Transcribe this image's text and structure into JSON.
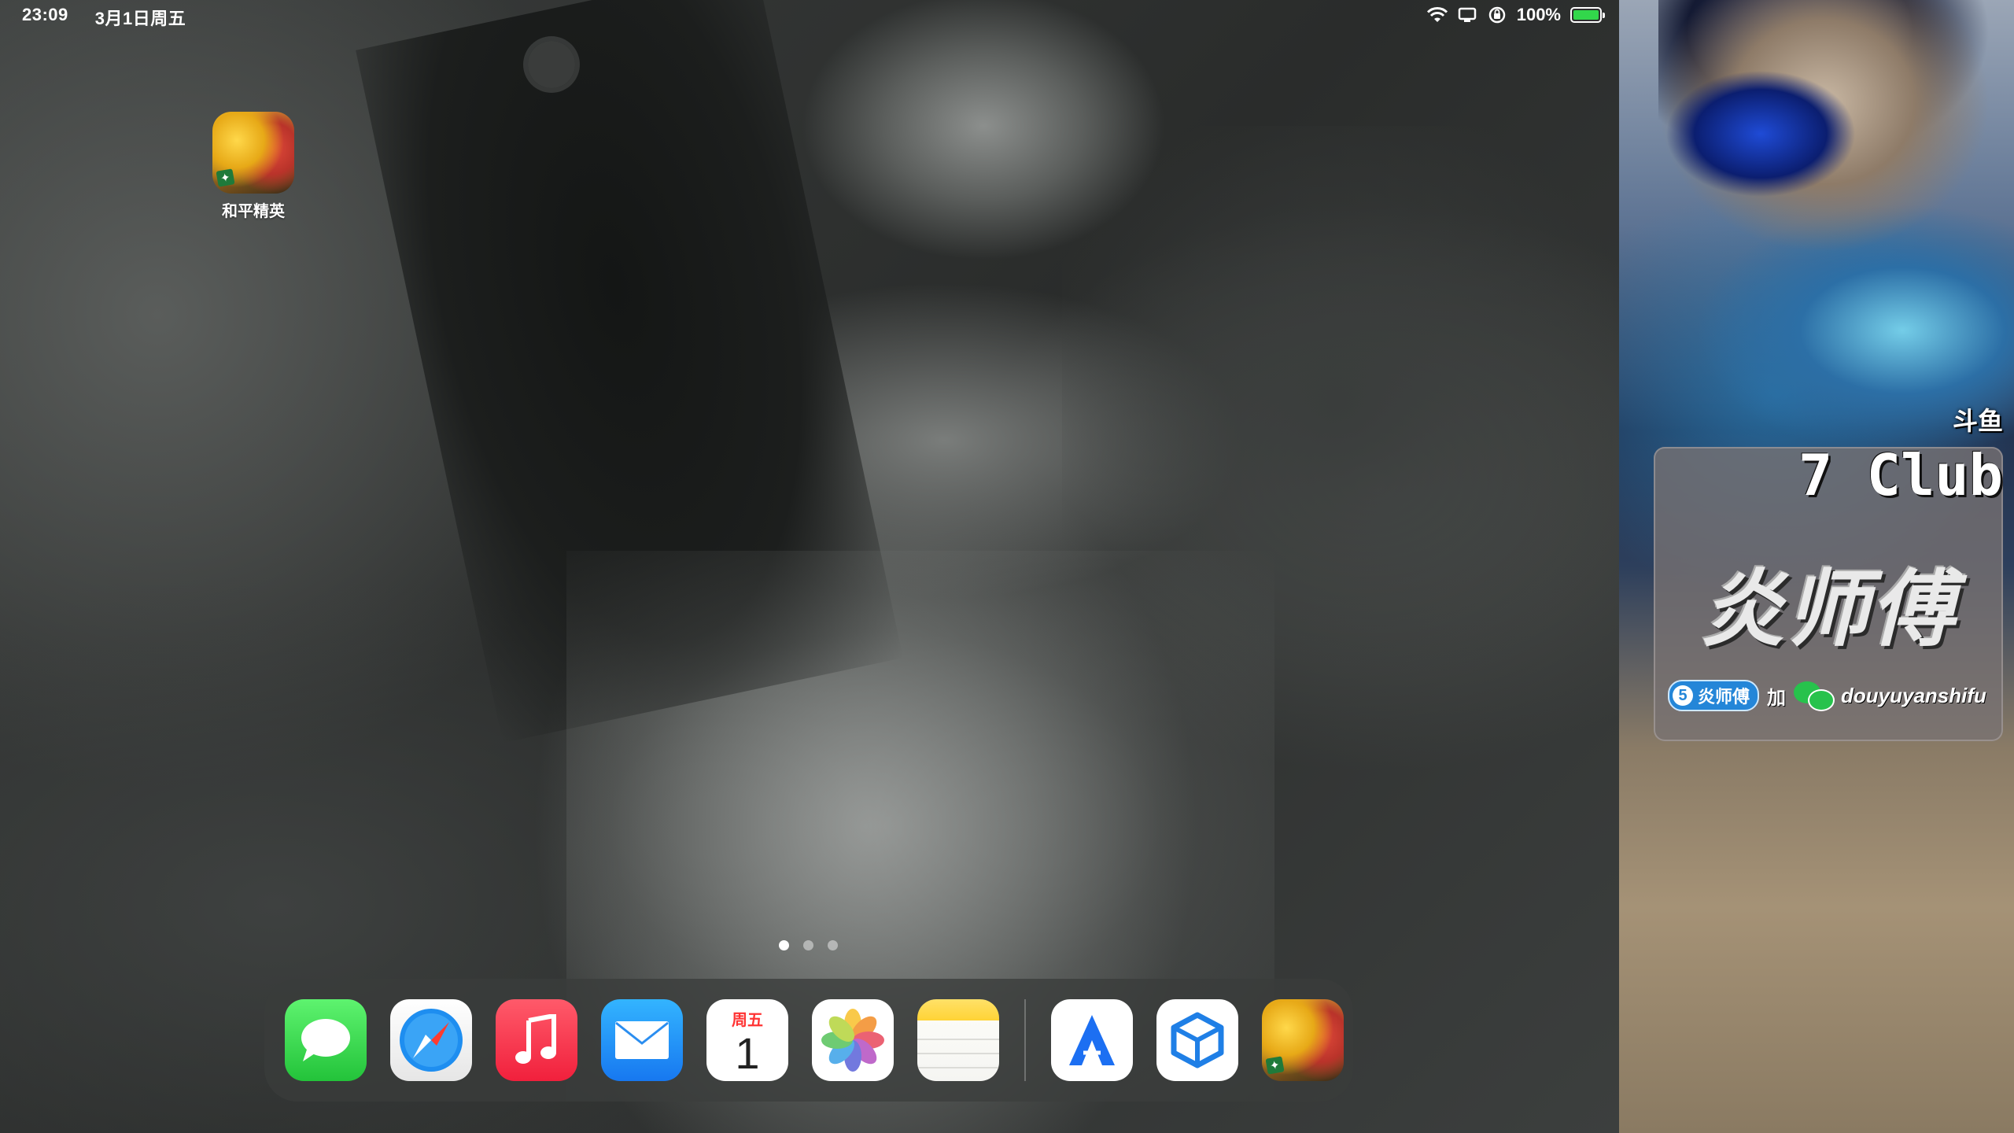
{
  "status_bar": {
    "time": "23:09",
    "date": "3月1日周五",
    "battery_percent": "100%",
    "battery_level": 1.0,
    "icons": [
      "wifi-icon",
      "screen-mirroring-icon",
      "orientation-lock-icon",
      "battery-charging-icon"
    ]
  },
  "home": {
    "apps": [
      {
        "label": "和平精英",
        "icon": "pubg-mobile-icon"
      }
    ],
    "page_count": 3,
    "current_page": 1
  },
  "dock": {
    "apps": [
      {
        "name": "messages",
        "icon": "messages-icon"
      },
      {
        "name": "safari",
        "icon": "safari-icon"
      },
      {
        "name": "music",
        "icon": "music-icon"
      },
      {
        "name": "mail",
        "icon": "mail-icon"
      },
      {
        "name": "calendar",
        "icon": "calendar-icon",
        "day": "周五",
        "date": "1"
      },
      {
        "name": "photos",
        "icon": "photos-icon"
      },
      {
        "name": "notes",
        "icon": "notes-icon"
      }
    ],
    "recent_apps": [
      {
        "name": "altstore",
        "icon": "altstore-icon"
      },
      {
        "name": "box",
        "icon": "box-app-icon"
      },
      {
        "name": "pubg",
        "icon": "pubg-mobile-icon"
      }
    ]
  },
  "stream_panel": {
    "platform": "斗鱼",
    "club": "7 Club",
    "streamer_name": "炎师傅",
    "badge_num": "5",
    "badge_label": "炎师傅",
    "plus_text": "加",
    "wechat_id": "douyuyanshifu",
    "colors": {
      "badge": "#2486d8",
      "wechat": "#27c24c"
    }
  }
}
